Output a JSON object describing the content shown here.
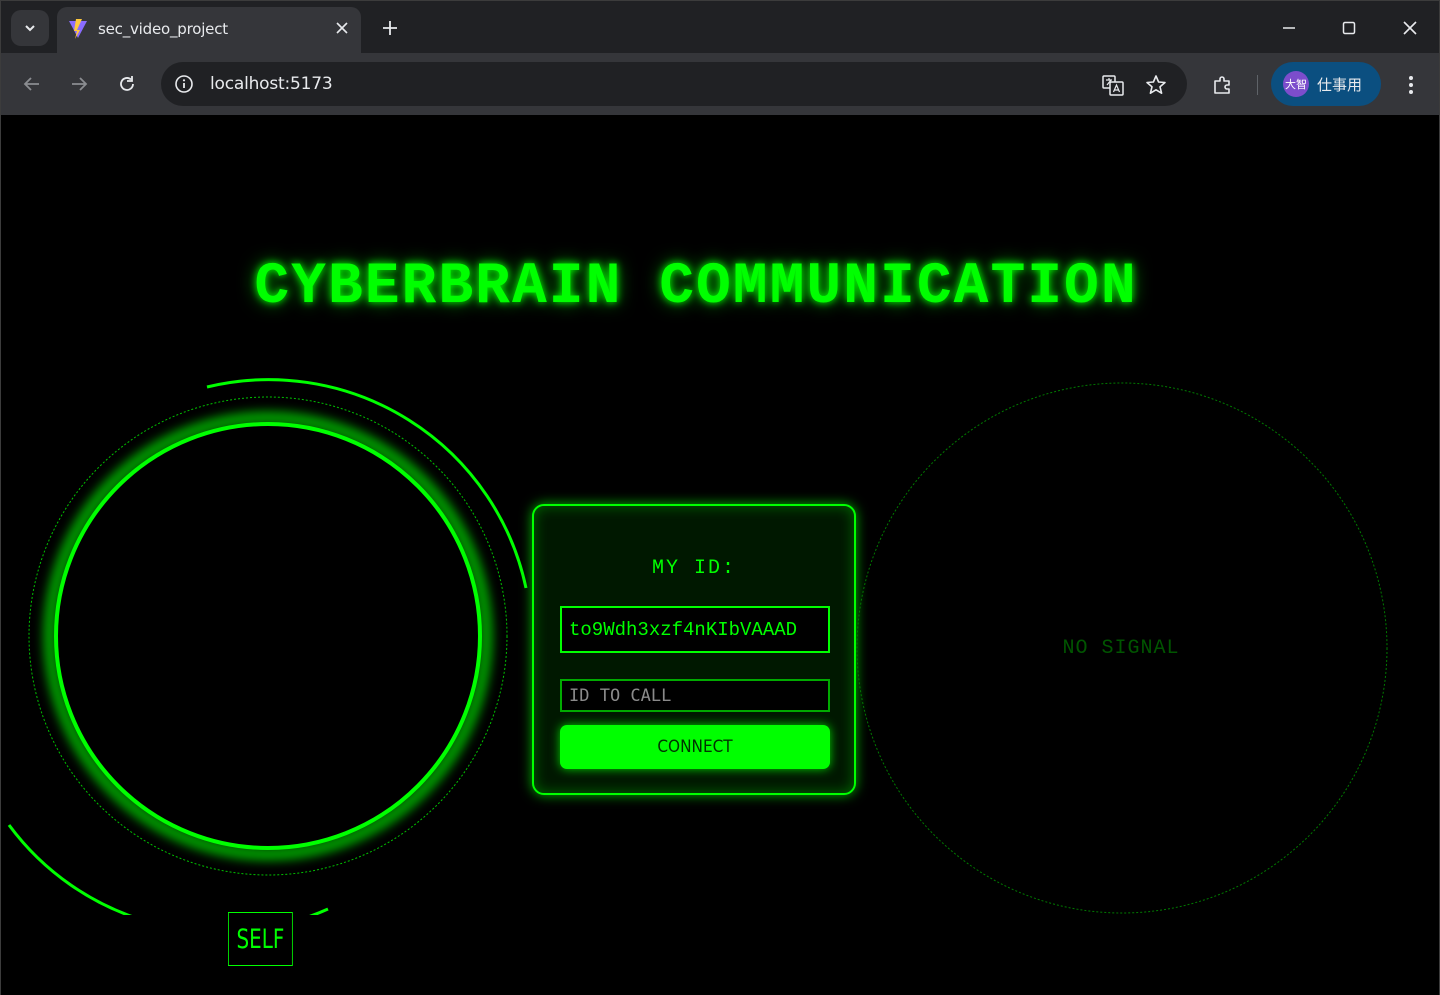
{
  "browser": {
    "tab_title": "sec_video_project",
    "url": "localhost:5173",
    "profile_avatar": "大智",
    "profile_label": "仕事用"
  },
  "app": {
    "title": "CYBERBRAIN COMMUNICATION",
    "self_label": "SELF",
    "my_id_label": "MY ID:",
    "my_id_value": "to9Wdh3xzf4nKIbVAAAD",
    "id_to_call_placeholder": "ID TO CALL",
    "id_to_call_value": "",
    "connect_label": "CONNECT",
    "remote_status": "NO SIGNAL"
  },
  "colors": {
    "accent": "#00ff00",
    "background": "#000000",
    "dim_accent": "#005500"
  }
}
